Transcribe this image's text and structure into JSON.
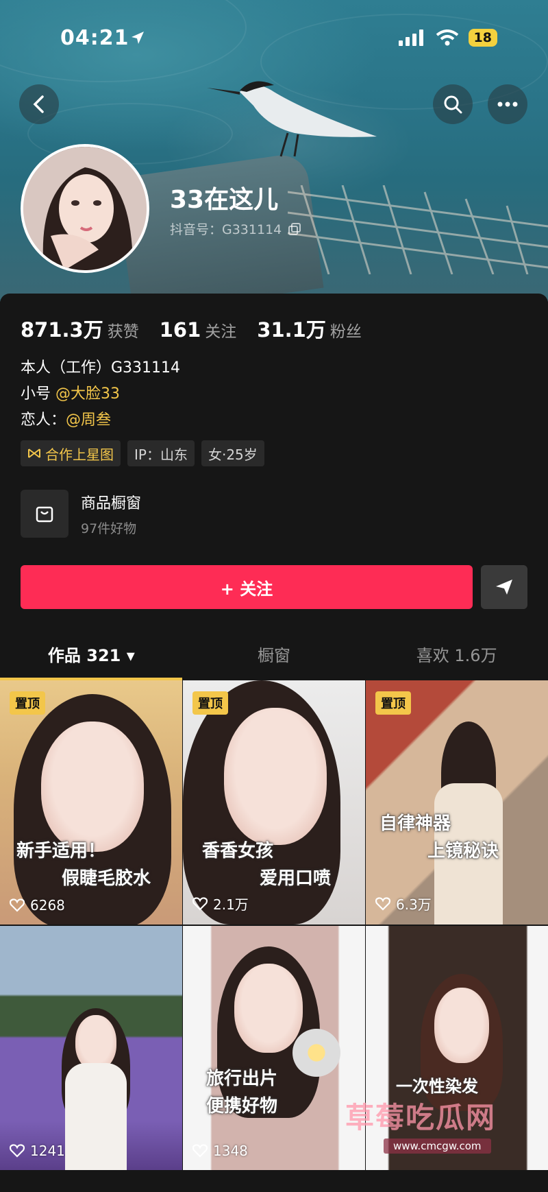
{
  "status_bar": {
    "time": "04:21",
    "battery": "18"
  },
  "profile": {
    "nickname": "33在这儿",
    "douyin_id": "抖音号：G331114"
  },
  "stats": [
    {
      "value": "871.3万",
      "label": "获赞"
    },
    {
      "value": "161",
      "label": "关注"
    },
    {
      "value": "31.1万",
      "label": "粉丝"
    }
  ],
  "bio": {
    "line1": "本人（工作）G331114",
    "line2_prefix": "小号",
    "line2_link": "@大脸33",
    "line3_prefix": "恋人：",
    "line3_link": "@周叁"
  },
  "tags": [
    "合作上星图",
    "IP：山东",
    "女·25岁"
  ],
  "shop": {
    "title": "商品橱窗",
    "subtitle": "97件好物"
  },
  "follow_label": "+ 关注",
  "tabs": [
    "作品 321 ▾",
    "橱窗",
    "喜欢 1.6万"
  ],
  "videos": [
    {
      "pinned": "置顶",
      "caption1": "新手适用！",
      "caption2": "假睫毛胶水",
      "likes": "6268"
    },
    {
      "pinned": "置顶",
      "caption1": "香香女孩",
      "caption2": "爱用口喷",
      "likes": "2.1万"
    },
    {
      "pinned": "置顶",
      "caption1": "自律神器",
      "caption2": "上镜秘诀",
      "likes": "6.3万"
    },
    {
      "pinned": "",
      "caption1": "",
      "caption2": "",
      "likes": "1241"
    },
    {
      "pinned": "",
      "caption1": "旅行出片",
      "caption2": "便携好物",
      "likes": "1348"
    },
    {
      "pinned": "",
      "caption1": "一次性染发",
      "caption2": "",
      "likes": ""
    }
  ],
  "watermark": {
    "text": "草莓吃瓜网",
    "url": "www.cmcgw.com"
  },
  "colors": {
    "accent": "#fe2c55",
    "gold": "#f3c64a",
    "background": "#161616"
  },
  "icons": [
    "back-icon",
    "search-icon",
    "more-icon",
    "bag-icon",
    "share-icon",
    "heart-icon",
    "star-chart-icon"
  ]
}
